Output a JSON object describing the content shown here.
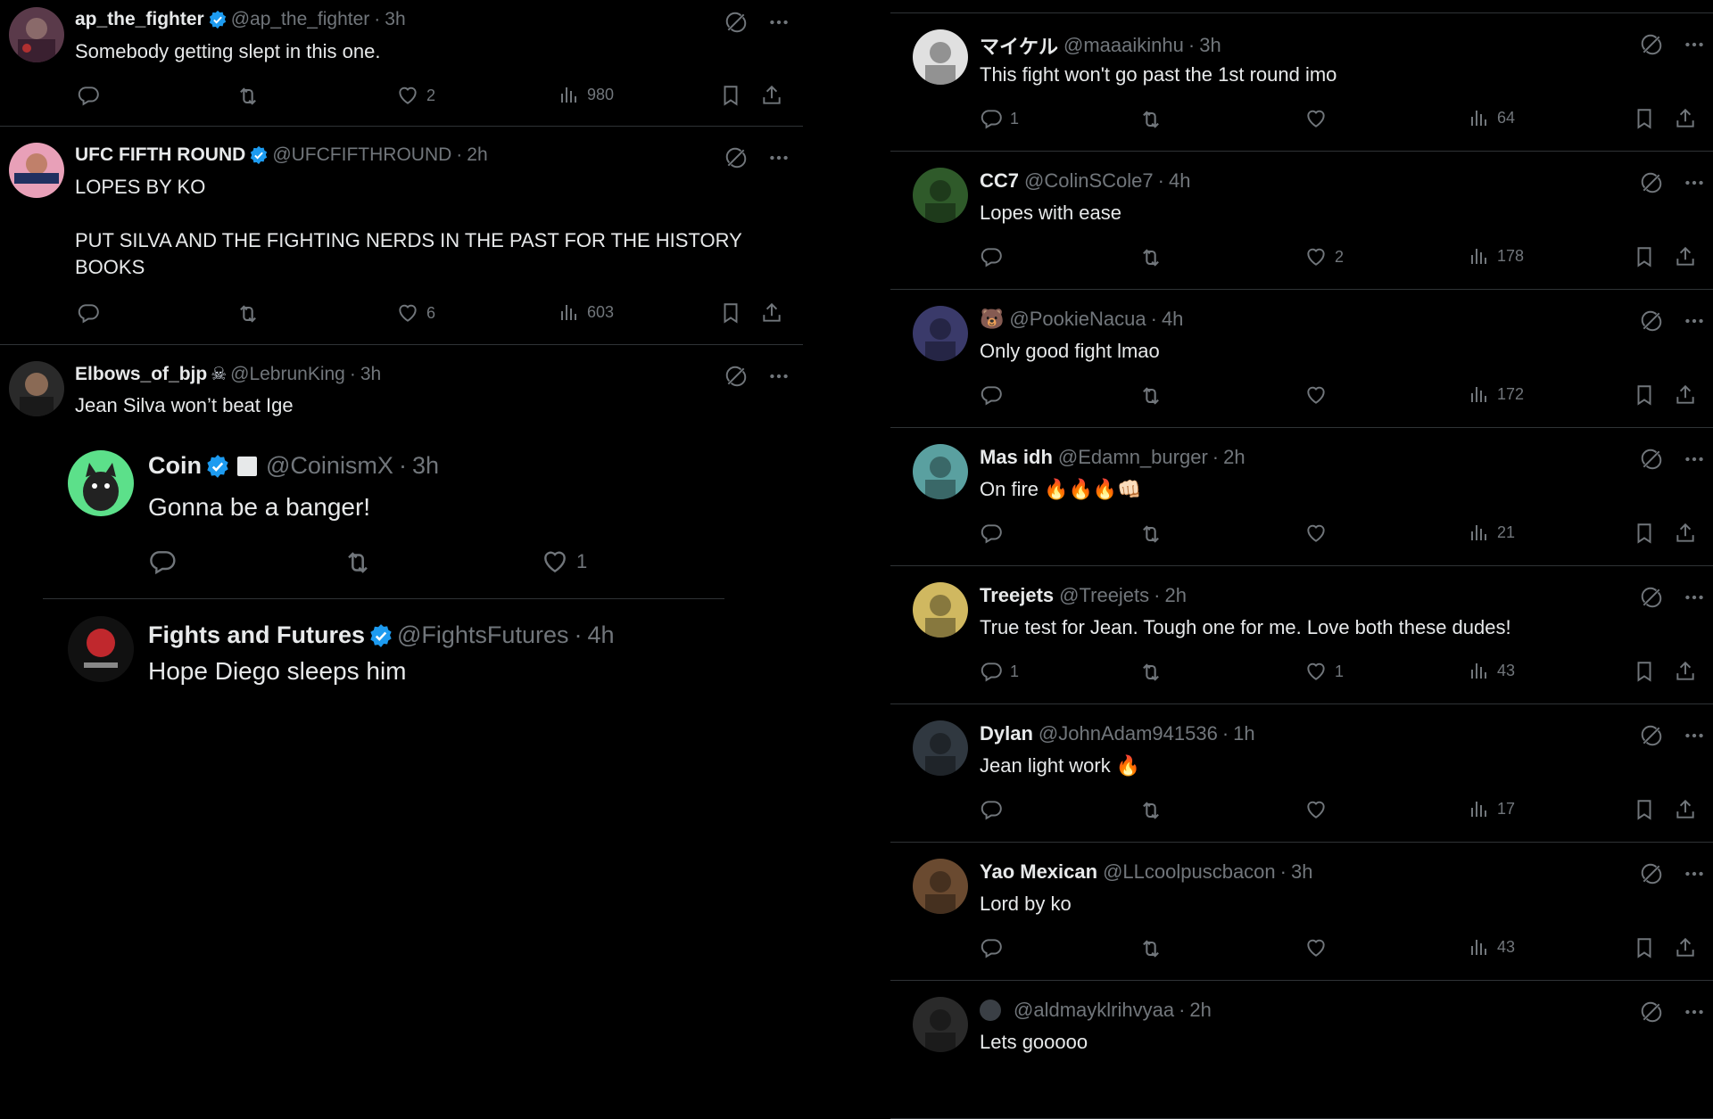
{
  "left_tweets": [
    {
      "name": "ap_the_fighter",
      "verified": true,
      "handle": "@ap_the_fighter",
      "time": "3h",
      "text": "Somebody getting slept in this one.",
      "replies": "",
      "likes": "2",
      "views": "980"
    },
    {
      "name": "UFC FIFTH ROUND",
      "verified": true,
      "handle": "@UFCFIFTHROUND",
      "time": "2h",
      "text": "LOPES BY KO\n\nPUT SILVA AND THE FIGHTING NERDS IN THE PAST FOR THE HISTORY BOOKS",
      "replies": "",
      "likes": "6",
      "views": "603"
    },
    {
      "name": "Elbows_of_bjp",
      "verified": false,
      "handle": "@LebrunKing",
      "time": "3h",
      "text": "Jean Silva won’t beat Ige"
    }
  ],
  "quoted": [
    {
      "name": "Coin",
      "verified": true,
      "handle": "@CoinismX",
      "time": "3h",
      "text": "Gonna be a banger!",
      "likes": "1"
    },
    {
      "name": "Fights and Futures",
      "verified": true,
      "handle": "@FightsFutures",
      "time": "4h",
      "text": "Hope Diego sleeps him"
    }
  ],
  "right_tweets": [
    {
      "name": "マイケル",
      "verified": false,
      "handle": "@maaaikinhu",
      "time": "3h",
      "text": "This fight won't go past the 1st round imo",
      "replies": "1",
      "likes": "",
      "views": "64"
    },
    {
      "name": "CC7",
      "verified": false,
      "handle": "@ColinSCole7",
      "time": "4h",
      "text": "Lopes with ease",
      "replies": "",
      "likes": "2",
      "views": "178"
    },
    {
      "name": "🐻",
      "verified": false,
      "handle": "@PookieNacua",
      "time": "4h",
      "text": "Only good fight lmao",
      "replies": "",
      "likes": "",
      "views": "172"
    },
    {
      "name": "Mas idh",
      "verified": false,
      "handle": "@Edamn_burger",
      "time": "2h",
      "text": "On fire 🔥🔥🔥👊🏻",
      "replies": "",
      "likes": "",
      "views": "21"
    },
    {
      "name": "Treejets",
      "verified": false,
      "handle": "@Treejets",
      "time": "2h",
      "text": "True test for Jean. Tough one for me. Love both these dudes!",
      "replies": "1",
      "likes": "1",
      "views": "43"
    },
    {
      "name": "Dylan",
      "verified": false,
      "handle": "@JohnAdam941536",
      "time": "1h",
      "text": "Jean light work 🔥",
      "replies": "",
      "likes": "",
      "views": "17"
    },
    {
      "name": "Yao Mexican",
      "verified": false,
      "handle": "@LLcoolpuscbacon",
      "time": "3h",
      "text": "Lord by ko",
      "replies": "",
      "likes": "",
      "views": "43"
    },
    {
      "name": "",
      "verified": false,
      "handle": "@aldmayklrihvyaa",
      "time": "2h",
      "text": "Lets gooooo",
      "replies": "",
      "likes": "",
      "views": ""
    }
  ],
  "separator": "·",
  "colors": {
    "background": "#000000",
    "text": "#e7e9ea",
    "muted": "#71767b",
    "border": "#2f3336",
    "verified": "#1d9bf0"
  }
}
